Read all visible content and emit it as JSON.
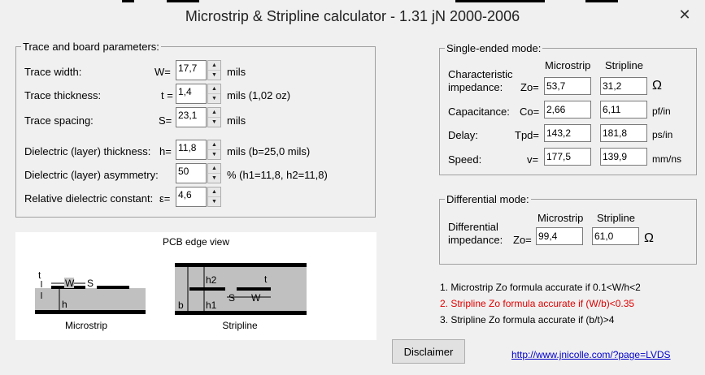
{
  "window": {
    "title": "Microstrip & Stripline calculator - 1.31 jN 2000-2006",
    "close_label": "✕"
  },
  "trace_params": {
    "legend": "Trace and board parameters:",
    "rows": {
      "width": {
        "label": "Trace width:",
        "symbol": "W=",
        "value": "17,7",
        "unit": "mils"
      },
      "thickness": {
        "label": "Trace thickness:",
        "symbol": "t =",
        "value": "1,4",
        "unit": "mils (1,02 oz)"
      },
      "spacing": {
        "label": "Trace spacing:",
        "symbol": "S=",
        "value": "23,1",
        "unit": "mils"
      },
      "dielectric_thickness": {
        "label": "Dielectric (layer) thickness:",
        "symbol": "h=",
        "value": "11,8",
        "unit": "mils (b=25,0 mils)"
      },
      "asymmetry": {
        "label": "Dielectric (layer) asymmetry:",
        "value": "50",
        "unit": "% (h1=11,8, h2=11,8)"
      },
      "dielectric_constant": {
        "label": "Relative dielectric constant:",
        "symbol": "ε=",
        "value": "4,6"
      }
    }
  },
  "pcb_view": {
    "title": "PCB edge view",
    "microstrip_label": "Microstrip",
    "stripline_label": "Stripline",
    "labels": {
      "t": "t",
      "W": "W",
      "S": "S",
      "h": "h",
      "h1": "h1",
      "h2": "h2",
      "b": "b"
    }
  },
  "single_ended": {
    "legend": "Single-ended mode:",
    "col_microstrip": "Microstrip",
    "col_stripline": "Stripline",
    "rows": {
      "impedance": {
        "label_line1": "Characteristic",
        "label_line2": "impedance:",
        "symbol": "Zo=",
        "microstrip": "53,7",
        "stripline": "31,2",
        "unit": "Ω"
      },
      "capacitance": {
        "label": "Capacitance:",
        "symbol": "Co=",
        "microstrip": "2,66",
        "stripline": "6,11",
        "unit": "pf/in"
      },
      "delay": {
        "label": "Delay:",
        "symbol": "Tpd=",
        "microstrip": "143,2",
        "stripline": "181,8",
        "unit": "ps/in"
      },
      "speed": {
        "label": "Speed:",
        "symbol": "v=",
        "microstrip": "177,5",
        "stripline": "139,9",
        "unit": "mm/ns"
      }
    }
  },
  "differential": {
    "legend": "Differential mode:",
    "col_microstrip": "Microstrip",
    "col_stripline": "Stripline",
    "label_line1": "Differential",
    "label_line2": "impedance:",
    "symbol": "Zo=",
    "microstrip": "99,4",
    "stripline": "61,0",
    "unit": "Ω"
  },
  "notes": [
    {
      "text": "1. Microstrip Zo formula accurate if 0.1<W/h<2",
      "color": "#000000"
    },
    {
      "text": "2. Stripline Zo formula accurate if (W/b)<0.35",
      "color": "#e00000"
    },
    {
      "text": "3. Stripline Zo formula accurate if (b/t)>4",
      "color": "#000000"
    }
  ],
  "disclaimer_label": "Disclaimer",
  "link_text": "http://www.jnicolle.com/?page=LVDS",
  "colors": {
    "substrate": "#c0c0c0",
    "copper": "#000000",
    "accent_red": "#e00000",
    "link": "#0000cc"
  }
}
